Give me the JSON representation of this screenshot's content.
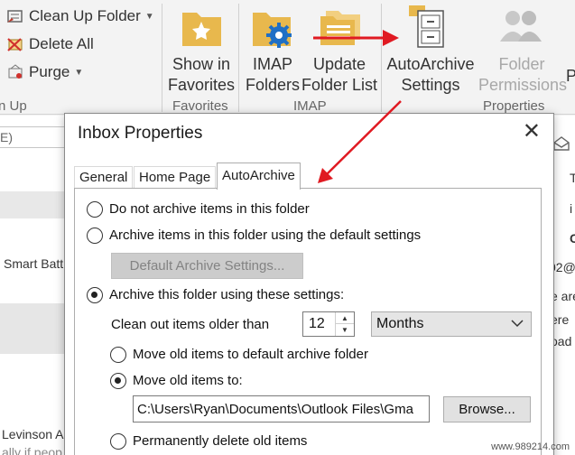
{
  "ribbon": {
    "commands": {
      "clean_up": "Clean Up Folder",
      "delete_all": "Delete All",
      "purge": "Purge"
    },
    "left_group_label": "n Up",
    "show_in_favorites": {
      "line1": "Show in",
      "line2": "Favorites"
    },
    "favorites_group": "Favorites",
    "imap_folders": {
      "line1": "IMAP",
      "line2": "Folders"
    },
    "update_folder_list": {
      "line1": "Update",
      "line2": "Folder List"
    },
    "imap_group": "IMAP",
    "autoarchive_settings": {
      "line1": "AutoArchive",
      "line2": "Settings"
    },
    "folder_permissions": {
      "line1": "Folder",
      "line2": "Permissions"
    },
    "properties_group": "Properties",
    "cut_letter": "P"
  },
  "background": {
    "search_fragment": "E)",
    "item1": "Smart Batt",
    "item2": "Levinson Al",
    "item3": "ally if peop",
    "right1": "T",
    "right2": "C",
    "right3": "02@",
    "right4": "e are",
    "right5": "ere",
    "right6": "oad"
  },
  "dialog": {
    "title": "Inbox Properties",
    "close_glyph": "✕",
    "tabs": [
      {
        "label": "General"
      },
      {
        "label": "Home Page"
      },
      {
        "label": "AutoArchive"
      }
    ],
    "options": {
      "do_not_archive": "Do not archive items in this folder",
      "archive_default": "Archive items in this folder using the default settings",
      "default_settings_button": "Default Archive Settings...",
      "archive_these": "Archive this folder using these settings:",
      "clean_out_label": "Clean out items older than",
      "clean_out_value": "12",
      "period": "Months",
      "move_default": "Move old items to default archive folder",
      "move_to": "Move old items to:",
      "path": "C:\\Users\\Ryan\\Documents\\Outlook Files\\Gma",
      "browse": "Browse...",
      "perm_delete": "Permanently delete old items"
    }
  },
  "watermark": "www.989214.com",
  "colors": {
    "arrow": "#e01a22",
    "folder": "#e8b84d",
    "gear": "#1f6fc5"
  }
}
